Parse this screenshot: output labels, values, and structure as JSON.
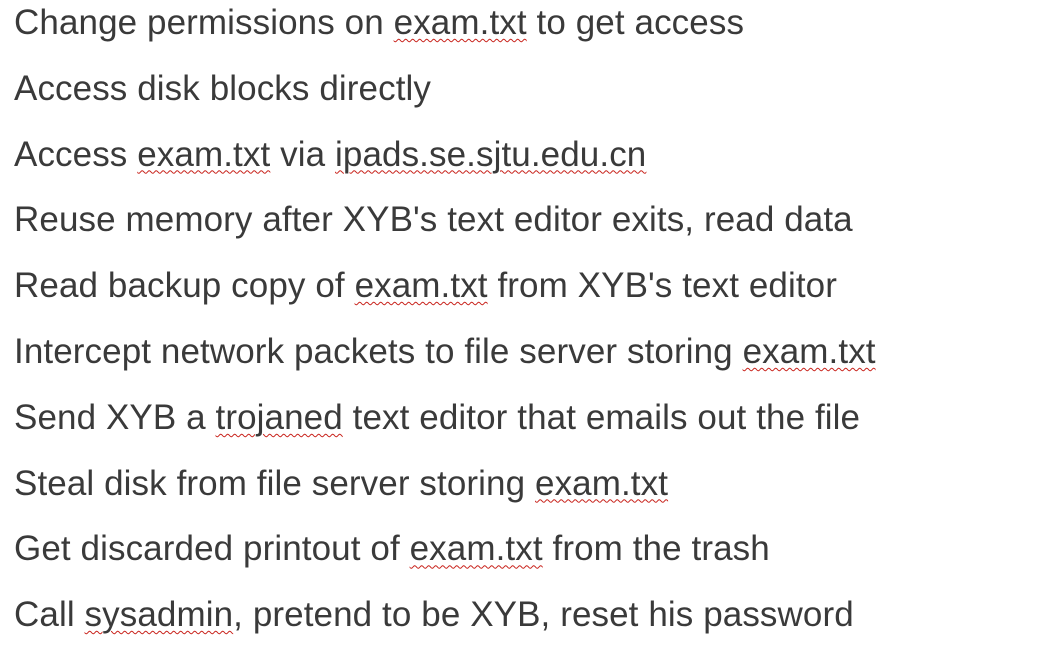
{
  "items": [
    {
      "parts": [
        "Change permissions on ",
        "exam.txt",
        " to get access"
      ]
    },
    {
      "parts": [
        "Access disk blocks directly"
      ]
    },
    {
      "parts": [
        "Access ",
        "exam.txt",
        " via ",
        "ipads.se.sjtu.edu.cn"
      ]
    },
    {
      "parts": [
        "Reuse memory after XYB's text editor exits, read data"
      ]
    },
    {
      "parts": [
        "Read backup copy of ",
        "exam.txt",
        " from XYB's text editor"
      ]
    },
    {
      "parts": [
        "Intercept network packets to file server storing ",
        "exam.txt"
      ]
    },
    {
      "parts": [
        "Send XYB a ",
        "trojaned",
        " text editor that emails out the file"
      ]
    },
    {
      "parts": [
        "Steal disk from file server storing ",
        "exam.txt"
      ]
    },
    {
      "parts": [
        "Get discarded printout of ",
        "exam.txt",
        " from the trash"
      ]
    },
    {
      "parts": [
        "Call ",
        "sysadmin",
        ", pretend to be XYB, reset his password"
      ]
    }
  ],
  "spellcheck_color": "#c8211a",
  "text_color": "#3a3a3a"
}
